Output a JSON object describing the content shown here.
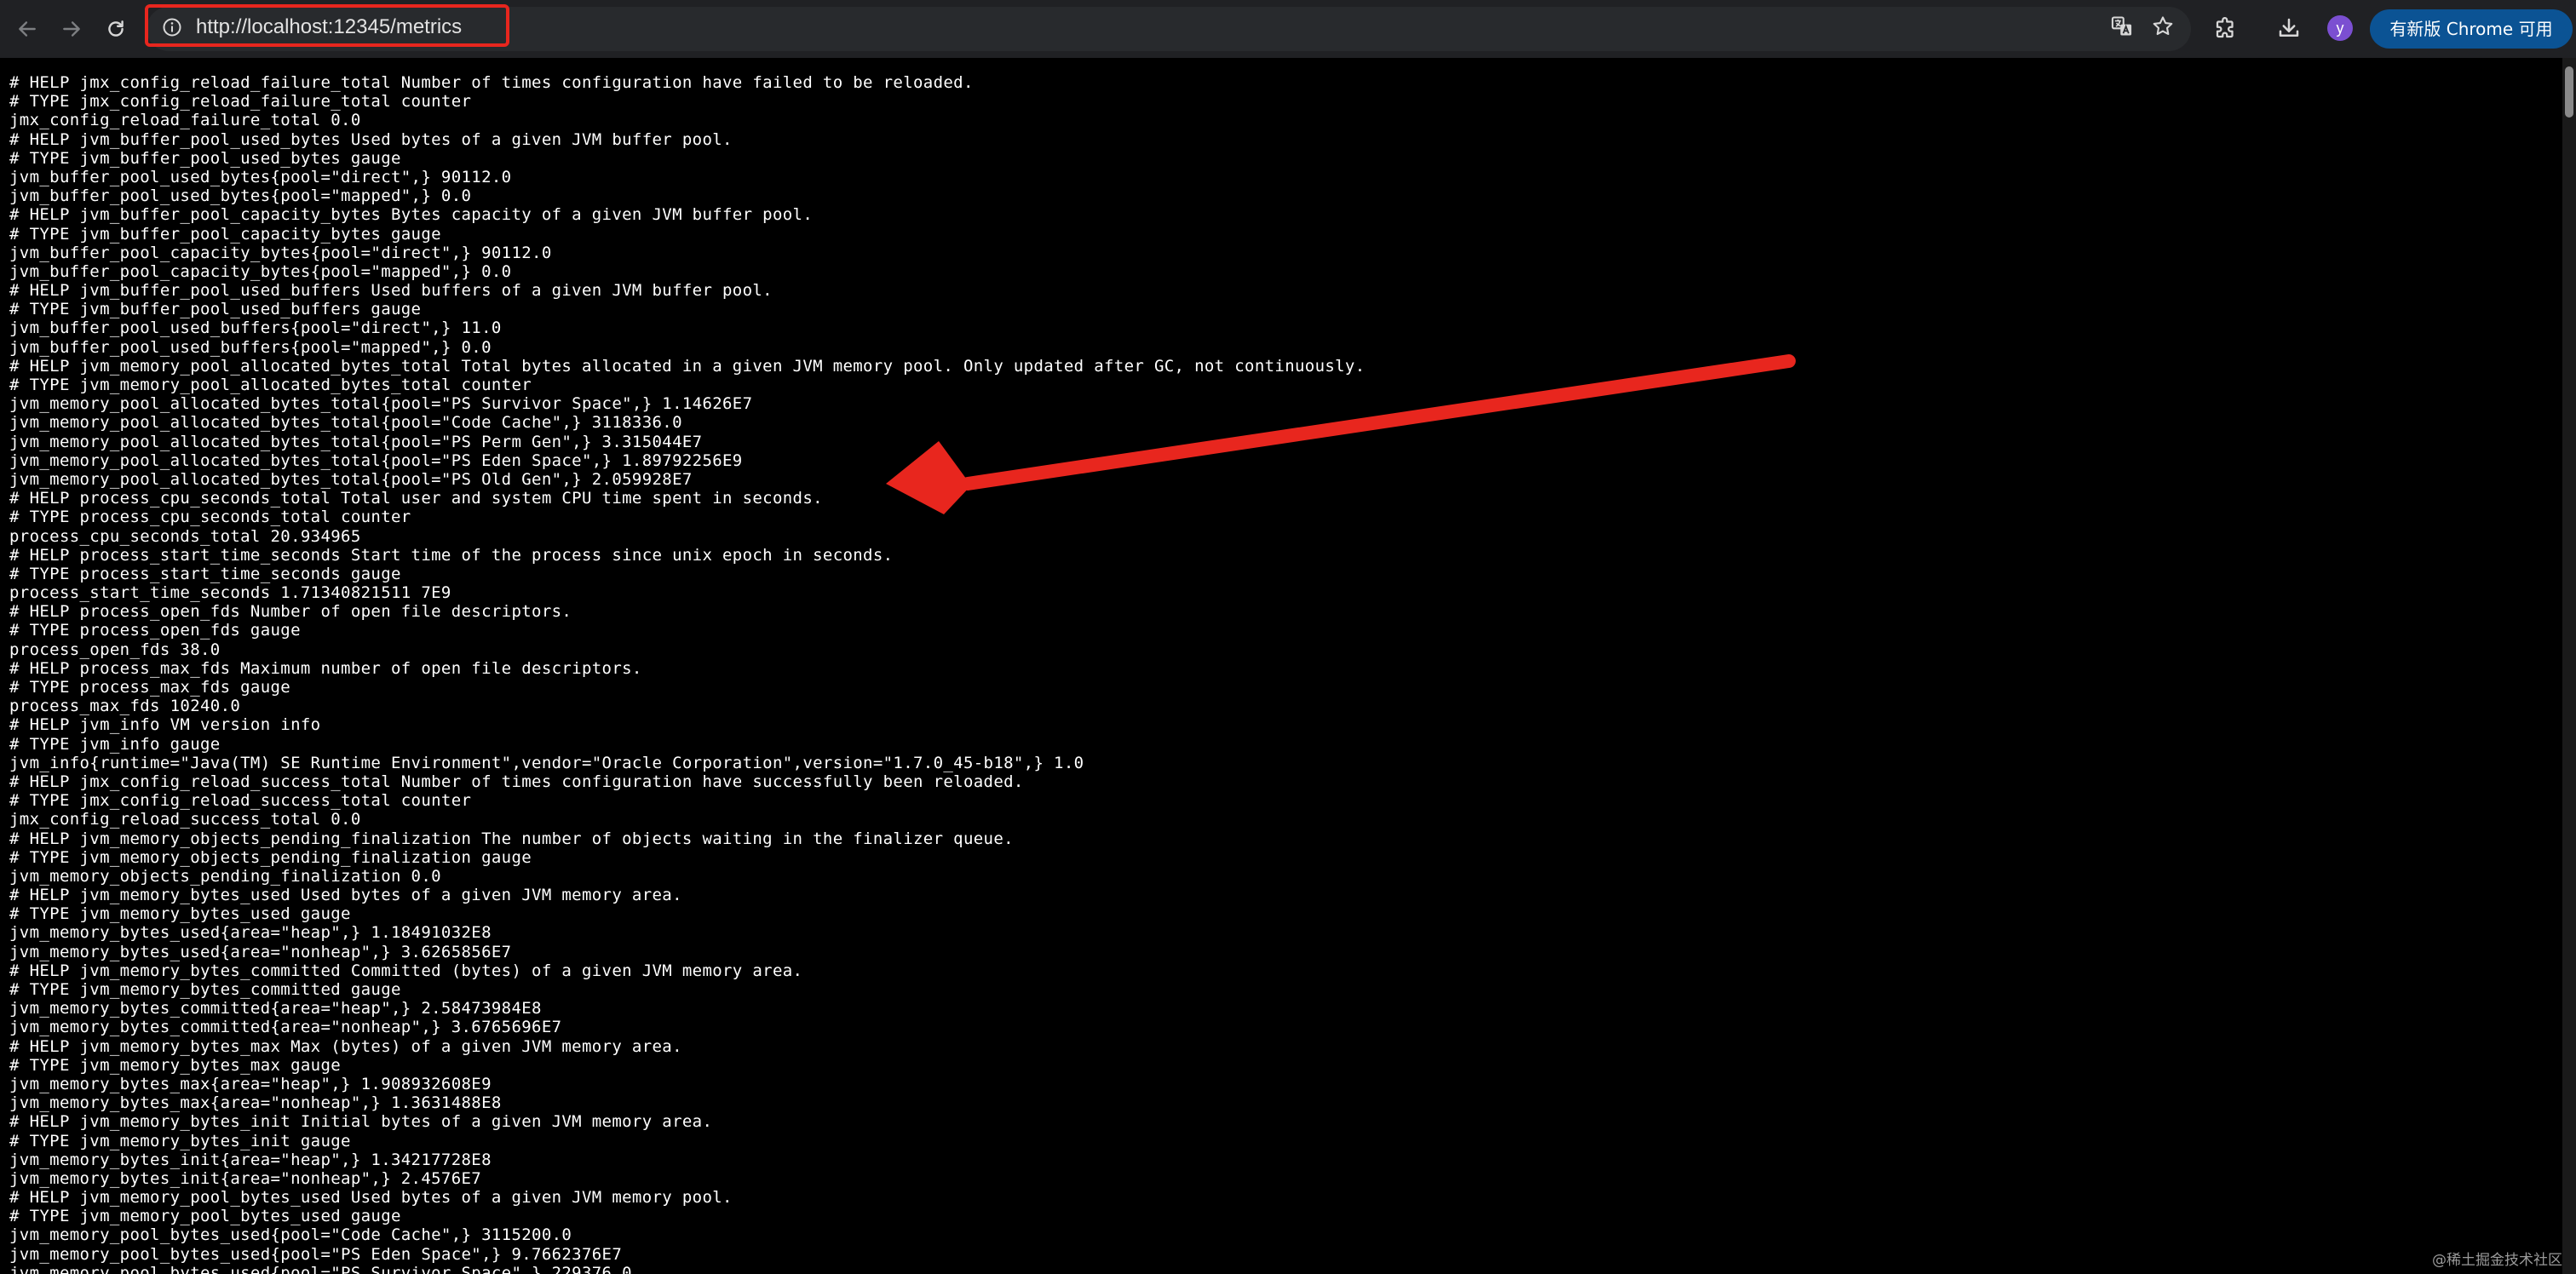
{
  "browser": {
    "url": "http://localhost:12345/metrics",
    "update_button_label": "有新版 Chrome 可用",
    "profile_initial": "y"
  },
  "icons": {
    "back": "arrow-left-icon",
    "forward": "arrow-right-icon",
    "reload": "reload-icon",
    "site_info": "info-icon",
    "translate": "translate-icon",
    "bookmark": "star-icon",
    "extensions": "puzzle-icon",
    "downloads": "download-icon"
  },
  "colors": {
    "annotation_arrow": "#e8261e",
    "update_pill": "#0b5394",
    "avatar": "#7b4fd1"
  },
  "metrics_lines": [
    "# HELP jmx_config_reload_failure_total Number of times configuration have failed to be reloaded.",
    "# TYPE jmx_config_reload_failure_total counter",
    "jmx_config_reload_failure_total 0.0",
    "# HELP jvm_buffer_pool_used_bytes Used bytes of a given JVM buffer pool.",
    "# TYPE jvm_buffer_pool_used_bytes gauge",
    "jvm_buffer_pool_used_bytes{pool=\"direct\",} 90112.0",
    "jvm_buffer_pool_used_bytes{pool=\"mapped\",} 0.0",
    "# HELP jvm_buffer_pool_capacity_bytes Bytes capacity of a given JVM buffer pool.",
    "# TYPE jvm_buffer_pool_capacity_bytes gauge",
    "jvm_buffer_pool_capacity_bytes{pool=\"direct\",} 90112.0",
    "jvm_buffer_pool_capacity_bytes{pool=\"mapped\",} 0.0",
    "# HELP jvm_buffer_pool_used_buffers Used buffers of a given JVM buffer pool.",
    "# TYPE jvm_buffer_pool_used_buffers gauge",
    "jvm_buffer_pool_used_buffers{pool=\"direct\",} 11.0",
    "jvm_buffer_pool_used_buffers{pool=\"mapped\",} 0.0",
    "# HELP jvm_memory_pool_allocated_bytes_total Total bytes allocated in a given JVM memory pool. Only updated after GC, not continuously.",
    "# TYPE jvm_memory_pool_allocated_bytes_total counter",
    "jvm_memory_pool_allocated_bytes_total{pool=\"PS Survivor Space\",} 1.14626E7",
    "jvm_memory_pool_allocated_bytes_total{pool=\"Code Cache\",} 3118336.0",
    "jvm_memory_pool_allocated_bytes_total{pool=\"PS Perm Gen\",} 3.315044E7",
    "jvm_memory_pool_allocated_bytes_total{pool=\"PS Eden Space\",} 1.89792256E9",
    "jvm_memory_pool_allocated_bytes_total{pool=\"PS Old Gen\",} 2.059928E7",
    "# HELP process_cpu_seconds_total Total user and system CPU time spent in seconds.",
    "# TYPE process_cpu_seconds_total counter",
    "process_cpu_seconds_total 20.934965",
    "# HELP process_start_time_seconds Start time of the process since unix epoch in seconds.",
    "# TYPE process_start_time_seconds gauge",
    "process_start_time_seconds 1.71340821511 7E9",
    "# HELP process_open_fds Number of open file descriptors.",
    "# TYPE process_open_fds gauge",
    "process_open_fds 38.0",
    "# HELP process_max_fds Maximum number of open file descriptors.",
    "# TYPE process_max_fds gauge",
    "process_max_fds 10240.0",
    "# HELP jvm_info VM version info",
    "# TYPE jvm_info gauge",
    "jvm_info{runtime=\"Java(TM) SE Runtime Environment\",vendor=\"Oracle Corporation\",version=\"1.7.0_45-b18\",} 1.0",
    "# HELP jmx_config_reload_success_total Number of times configuration have successfully been reloaded.",
    "# TYPE jmx_config_reload_success_total counter",
    "jmx_config_reload_success_total 0.0",
    "# HELP jvm_memory_objects_pending_finalization The number of objects waiting in the finalizer queue.",
    "# TYPE jvm_memory_objects_pending_finalization gauge",
    "jvm_memory_objects_pending_finalization 0.0",
    "# HELP jvm_memory_bytes_used Used bytes of a given JVM memory area.",
    "# TYPE jvm_memory_bytes_used gauge",
    "jvm_memory_bytes_used{area=\"heap\",} 1.18491032E8",
    "jvm_memory_bytes_used{area=\"nonheap\",} 3.6265856E7",
    "# HELP jvm_memory_bytes_committed Committed (bytes) of a given JVM memory area.",
    "# TYPE jvm_memory_bytes_committed gauge",
    "jvm_memory_bytes_committed{area=\"heap\",} 2.58473984E8",
    "jvm_memory_bytes_committed{area=\"nonheap\",} 3.6765696E7",
    "# HELP jvm_memory_bytes_max Max (bytes) of a given JVM memory area.",
    "# TYPE jvm_memory_bytes_max gauge",
    "jvm_memory_bytes_max{area=\"heap\",} 1.908932608E9",
    "jvm_memory_bytes_max{area=\"nonheap\",} 1.3631488E8",
    "# HELP jvm_memory_bytes_init Initial bytes of a given JVM memory area.",
    "# TYPE jvm_memory_bytes_init gauge",
    "jvm_memory_bytes_init{area=\"heap\",} 1.34217728E8",
    "jvm_memory_bytes_init{area=\"nonheap\",} 2.4576E7",
    "# HELP jvm_memory_pool_bytes_used Used bytes of a given JVM memory pool.",
    "# TYPE jvm_memory_pool_bytes_used gauge",
    "jvm_memory_pool_bytes_used{pool=\"Code Cache\",} 3115200.0",
    "jvm_memory_pool_bytes_used{pool=\"PS Eden Space\",} 9.7662376E7",
    "jvm_memory_pool_bytes_used{pool=\"PS Survivor Space\",} 229376.0"
  ],
  "watermark": "@稀土掘金技术社区"
}
